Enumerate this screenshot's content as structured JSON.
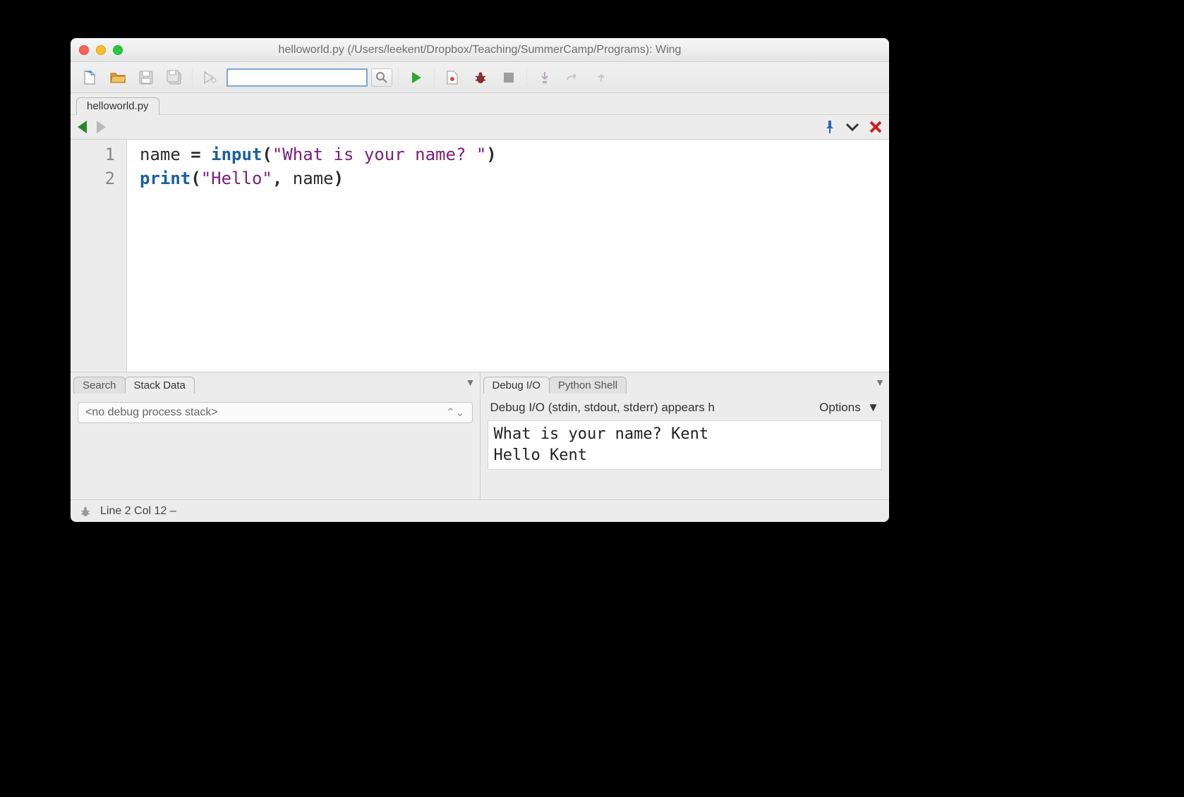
{
  "window": {
    "title": "helloworld.py (/Users/leekent/Dropbox/Teaching/SummerCamp/Programs): Wing"
  },
  "toolbar": {
    "search_value": ""
  },
  "file_tab": {
    "label": "helloworld.py"
  },
  "editor": {
    "lines": [
      {
        "num": "1",
        "tokens": [
          {
            "t": "ident",
            "v": "name "
          },
          {
            "t": "op",
            "v": "="
          },
          {
            "t": "ident",
            "v": " "
          },
          {
            "t": "kw-fn",
            "v": "input"
          },
          {
            "t": "op",
            "v": "("
          },
          {
            "t": "str",
            "v": "\"What is your name? \""
          },
          {
            "t": "op",
            "v": ")"
          }
        ]
      },
      {
        "num": "2",
        "tokens": [
          {
            "t": "kw-fn",
            "v": "print"
          },
          {
            "t": "op",
            "v": "("
          },
          {
            "t": "str",
            "v": "\"Hello\""
          },
          {
            "t": "op",
            "v": ","
          },
          {
            "t": "ident",
            "v": " name"
          },
          {
            "t": "op",
            "v": ")"
          }
        ]
      }
    ]
  },
  "left_panel": {
    "tabs": [
      "Search",
      "Stack Data"
    ],
    "active_tab": 1,
    "stack_text": "<no debug process stack>"
  },
  "right_panel": {
    "tabs": [
      "Debug I/O",
      "Python Shell"
    ],
    "active_tab": 0,
    "header": "Debug I/O (stdin, stdout, stderr) appears h",
    "options_label": "Options",
    "output": "What is your name? Kent\nHello Kent"
  },
  "status": {
    "text": "Line 2 Col 12 –"
  }
}
